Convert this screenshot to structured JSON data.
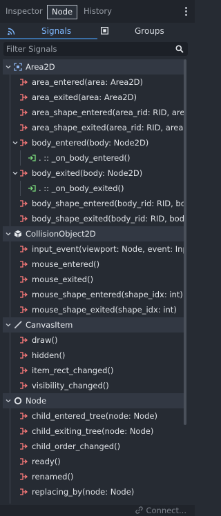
{
  "tabs": {
    "inspector": "Inspector",
    "node": "Node",
    "history": "History"
  },
  "subtabs": {
    "signals": "Signals",
    "groups": "Groups"
  },
  "filter": {
    "placeholder": "Filter Signals"
  },
  "tree": {
    "area2d": {
      "label": "Area2D",
      "signals": [
        "area_entered(area: Area2D)",
        "area_exited(area: Area2D)",
        "area_shape_entered(area_rid: RID, area:...",
        "area_shape_exited(area_rid: RID, area: ...",
        "body_entered(body: Node2D)",
        ". :: _on_body_entered()",
        "body_exited(body: Node2D)",
        ". :: _on_body_exited()",
        "body_shape_entered(body_rid: RID, bod...",
        "body_shape_exited(body_rid: RID, body:..."
      ]
    },
    "collision": {
      "label": "CollisionObject2D",
      "signals": [
        "input_event(viewport: Node, event: Inp...",
        "mouse_entered()",
        "mouse_exited()",
        "mouse_shape_entered(shape_idx: int)",
        "mouse_shape_exited(shape_idx: int)"
      ]
    },
    "canvasitem": {
      "label": "CanvasItem",
      "signals": [
        "draw()",
        "hidden()",
        "item_rect_changed()",
        "visibility_changed()"
      ]
    },
    "node": {
      "label": "Node",
      "signals": [
        "child_entered_tree(node: Node)",
        "child_exiting_tree(node: Node)",
        "child_order_changed()",
        "ready()",
        "renamed()",
        "replacing_by(node: Node)"
      ]
    }
  },
  "footer": {
    "connect": "Connect..."
  },
  "colors": {
    "accent": "#7eb8ff",
    "signal_icon": "#ff7b7b",
    "slot_icon": "#7ee07e",
    "header_bg": "#323843",
    "panel_bg": "#262b33"
  }
}
